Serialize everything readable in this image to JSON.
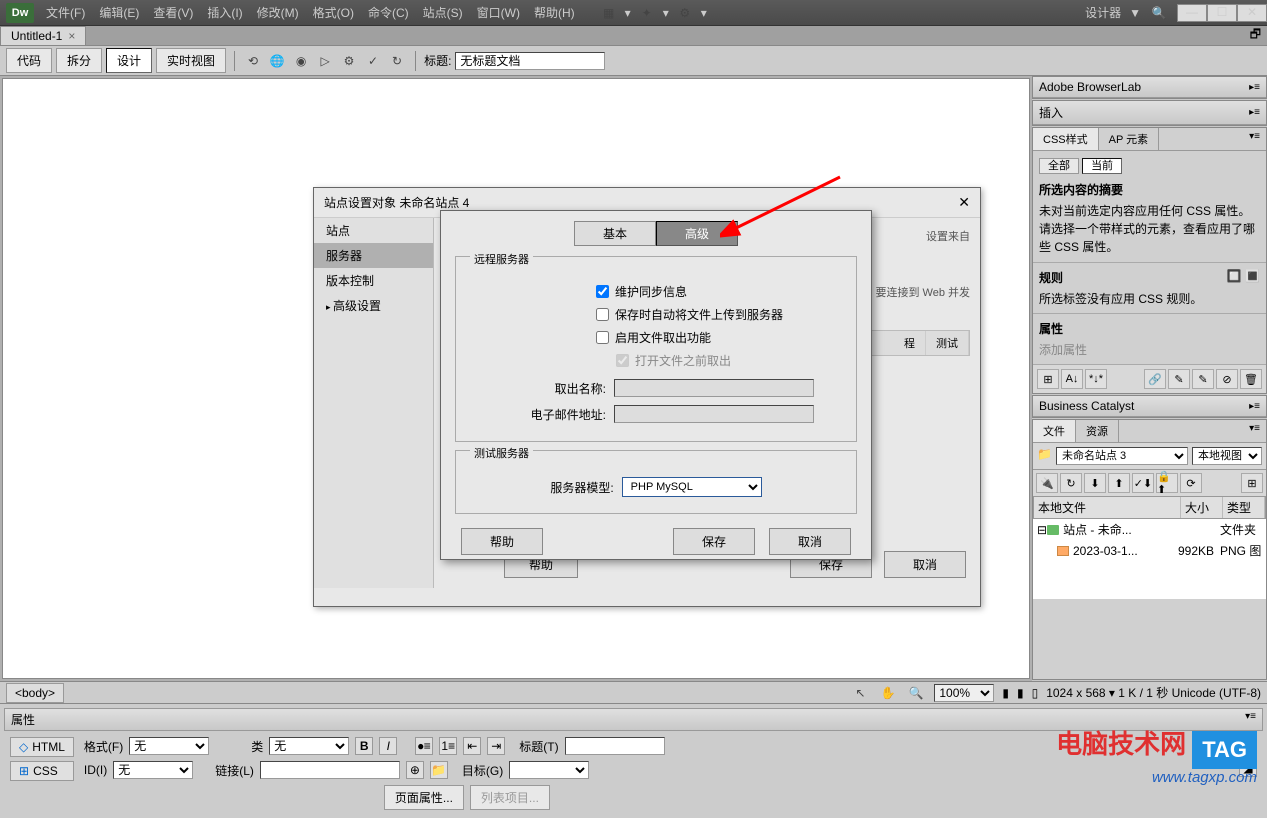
{
  "menubar": {
    "items": [
      "文件(F)",
      "编辑(E)",
      "查看(V)",
      "插入(I)",
      "修改(M)",
      "格式(O)",
      "命令(C)",
      "站点(S)",
      "窗口(W)",
      "帮助(H)"
    ]
  },
  "title_right": {
    "designer": "设计器",
    "dropdown": "▼"
  },
  "doc_tab": {
    "name": "Untitled-1"
  },
  "toolbar": {
    "code": "代码",
    "split": "拆分",
    "design": "设计",
    "live": "实时视图",
    "title_label": "标题:",
    "title_value": "无标题文档"
  },
  "status": {
    "tag": "<body>",
    "zoom": "100%",
    "info": "1024 x 568 ▾ 1 K / 1 秒 Unicode (UTF-8)"
  },
  "panels": {
    "browserlab": "Adobe BrowserLab",
    "insert": "插入",
    "css": "CSS样式",
    "ap": "AP 元素",
    "all": "全部",
    "current": "当前",
    "summary_title": "所选内容的摘要",
    "summary_text": "未对当前选定内容应用任何 CSS 属性。请选择一个带样式的元素，查看应用了哪些 CSS 属性。",
    "rules_title": "规则",
    "rules_text": "所选标签没有应用 CSS 规则。",
    "props_title": "属性",
    "add_prop": "添加属性",
    "biz": "Business Catalyst",
    "files": "文件",
    "assets": "资源",
    "site_sel": "未命名站点 3",
    "view_sel": "本地视图",
    "col_file": "本地文件",
    "col_size": "大小",
    "col_type": "类型",
    "root": "站点 - 未命...",
    "root_type": "文件夹",
    "file1": "2023-03-1...",
    "file1_size": "992KB",
    "file1_type": "PNG 图"
  },
  "props": {
    "header": "属性",
    "html": "HTML",
    "css": "CSS",
    "format_l": "格式(F)",
    "format_v": "无",
    "id_l": "ID(I)",
    "id_v": "无",
    "class_l": "类",
    "class_v": "无",
    "link_l": "链接(L)",
    "title_l": "标题(T)",
    "target_l": "目标(G)",
    "page_props": "页面属性...",
    "list_items": "列表项目..."
  },
  "dialog1": {
    "title": "站点设置对象 未命名站点 4",
    "side_site": "站点",
    "side_server": "服务器",
    "side_version": "版本控制",
    "side_adv": "高级设置",
    "hint1": "设置来自",
    "hint2": "要连接到 Web 并发",
    "col_remote": "程",
    "col_test": "测试",
    "help": "帮助",
    "save": "保存",
    "cancel": "取消"
  },
  "dialog2": {
    "basic": "基本",
    "advanced": "高级",
    "remote_title": "远程服务器",
    "chk_sync": "维护同步信息",
    "chk_upload": "保存时自动将文件上传到服务器",
    "chk_checkout": "启用文件取出功能",
    "chk_openfirst": "打开文件之前取出",
    "name_label": "取出名称:",
    "email_label": "电子邮件地址:",
    "test_title": "测试服务器",
    "model_label": "服务器模型:",
    "model_value": "PHP MySQL",
    "help": "帮助",
    "save": "保存",
    "cancel": "取消"
  },
  "watermark": {
    "brand": "电脑技术网",
    "tag": "TAG",
    "url": "www.tagxp.com"
  }
}
